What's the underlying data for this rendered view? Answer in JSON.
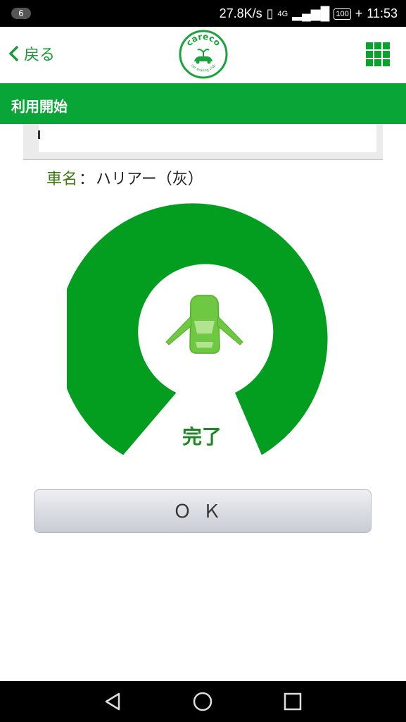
{
  "status_bar": {
    "notification_count": "6",
    "network_speed": "27.8K/s",
    "network_type": "4G",
    "battery": "100",
    "time": "11:53"
  },
  "header": {
    "back_label": "戻る",
    "logo_text_top": "careco",
    "logo_text_bottom": "car sharing club",
    "menu_icon": "grid-menu-icon"
  },
  "title_bar": {
    "title": "利用開始"
  },
  "car": {
    "name_label": "車名",
    "separator": "：",
    "name_value": "ハリアー（灰）"
  },
  "status": {
    "done_label": "完了",
    "icon": "car-doors-open-icon"
  },
  "actions": {
    "ok_label": "ＯＫ"
  },
  "colors": {
    "brand_green": "#09a536",
    "gauge_green": "#039e20",
    "text_green": "#1b8a20"
  }
}
